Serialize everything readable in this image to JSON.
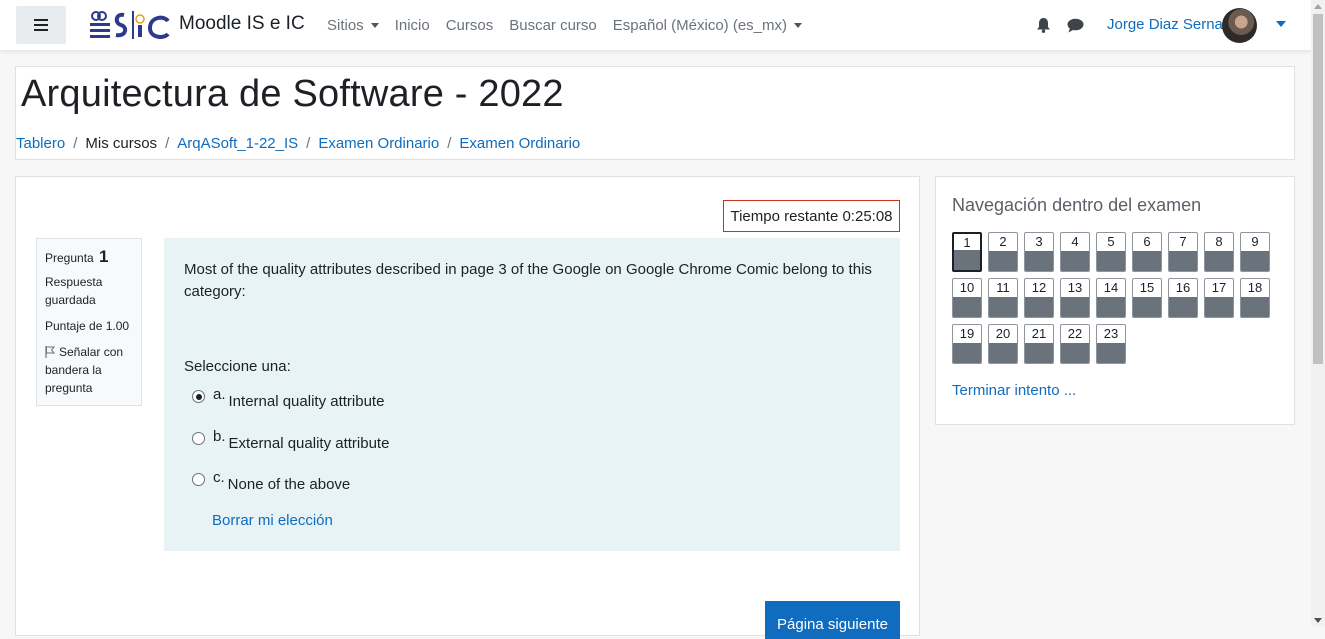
{
  "navbar": {
    "site_name": "Moodle IS e IC",
    "links": [
      {
        "label": "Sitios",
        "dropdown": true
      },
      {
        "label": "Inicio",
        "dropdown": false
      },
      {
        "label": "Cursos",
        "dropdown": false
      },
      {
        "label": "Buscar curso",
        "dropdown": false
      },
      {
        "label": "Español (México) (es_mx)",
        "dropdown": true
      }
    ],
    "user_name": "Jorge Diaz Serna",
    "icons": [
      "hamburger-menu-icon",
      "bell-icon",
      "chat-icon",
      "user-menu-caret-icon"
    ]
  },
  "header": {
    "course_title": "Arquitectura de Software - 2022",
    "breadcrumb": [
      "Tablero",
      "Mis cursos",
      "ArqASoft_1-22_IS",
      "Examen Ordinario",
      "Examen Ordinario"
    ]
  },
  "quiz": {
    "timer": "Tiempo restante 0:25:08",
    "question_info": {
      "label": "Pregunta",
      "number": "1",
      "state": "Respuesta guardada",
      "grade": "Puntaje de 1.00",
      "flag": "Señalar con bandera la pregunta"
    },
    "question_text": "Most of the quality attributes described in page 3 of the Google on Google Chrome Comic belong to this category:",
    "prompt": "Seleccione una:",
    "answers": [
      {
        "letter": "a.",
        "text": "Internal quality attribute",
        "selected": true
      },
      {
        "letter": "b.",
        "text": "External quality attribute",
        "selected": false
      },
      {
        "letter": "c.",
        "text": "None of the above",
        "selected": false
      }
    ],
    "clear_choice": "Borrar mi elección",
    "next_button": "Página siguiente"
  },
  "navigation": {
    "title": "Navegación dentro del examen",
    "questions": [
      "1",
      "2",
      "3",
      "4",
      "5",
      "6",
      "7",
      "8",
      "9",
      "10",
      "11",
      "12",
      "13",
      "14",
      "15",
      "16",
      "17",
      "18",
      "19",
      "20",
      "21",
      "22",
      "23"
    ],
    "current": "1",
    "finish_link": "Terminar intento ..."
  },
  "colors": {
    "link": "#0f6cbf",
    "primary_button": "#0f6cbf",
    "timer_border": "#ca3120",
    "question_bg": "#e7f3f5",
    "answered_fill": "#6a737b"
  }
}
